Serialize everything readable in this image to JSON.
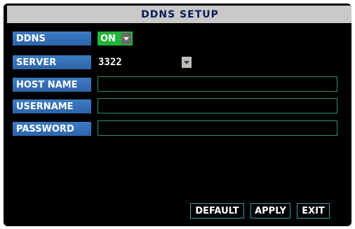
{
  "title": "DDNS SETUP",
  "fields": {
    "ddns": {
      "label": "DDNS",
      "value": "ON",
      "color": "#23b43a"
    },
    "server": {
      "label": "SERVER",
      "value": "3322"
    },
    "host_name": {
      "label": "HOST NAME",
      "value": ""
    },
    "username": {
      "label": "USERNAME",
      "value": ""
    },
    "password": {
      "label": "PASSWORD",
      "value": ""
    }
  },
  "buttons": {
    "default": "DEFAULT",
    "apply": "APPLY",
    "exit": "EXIT"
  },
  "colors": {
    "label_bg": "#2f64aa",
    "title_bg": "#c9c9c9",
    "field_border": "#2e8c7a"
  }
}
